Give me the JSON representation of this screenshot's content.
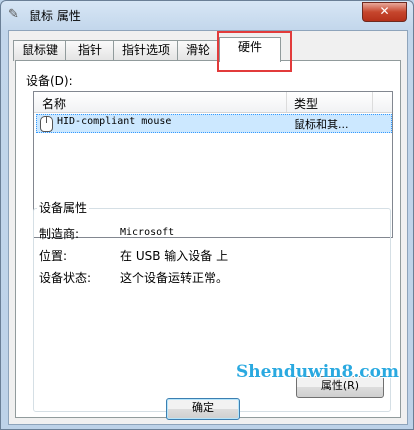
{
  "window": {
    "title": "鼠标 属性",
    "close_label": "✕"
  },
  "tabs": [
    {
      "label": "鼠标键"
    },
    {
      "label": "指针"
    },
    {
      "label": "指针选项"
    },
    {
      "label": "滑轮"
    },
    {
      "label": "硬件"
    }
  ],
  "active_tab": "硬件",
  "devices": {
    "label": "设备(D):",
    "columns": [
      "名称",
      "类型"
    ],
    "rows": [
      {
        "name": "HID-compliant mouse",
        "type": "鼠标和其..."
      }
    ]
  },
  "properties": {
    "title": "设备属性",
    "items": [
      {
        "label": "制造商:",
        "value": "Microsoft"
      },
      {
        "label": "位置:",
        "value": "在 USB 输入设备 上"
      },
      {
        "label": "设备状态:",
        "value": "这个设备运转正常。"
      }
    ],
    "button_label": "属性(R)"
  },
  "footer": {
    "ok_label": "确定"
  },
  "watermark": "Shenduwin8.com",
  "colors": {
    "highlight": "#e23b3b",
    "selection": "#cce8ff",
    "watermark": "#2aa9e0"
  }
}
